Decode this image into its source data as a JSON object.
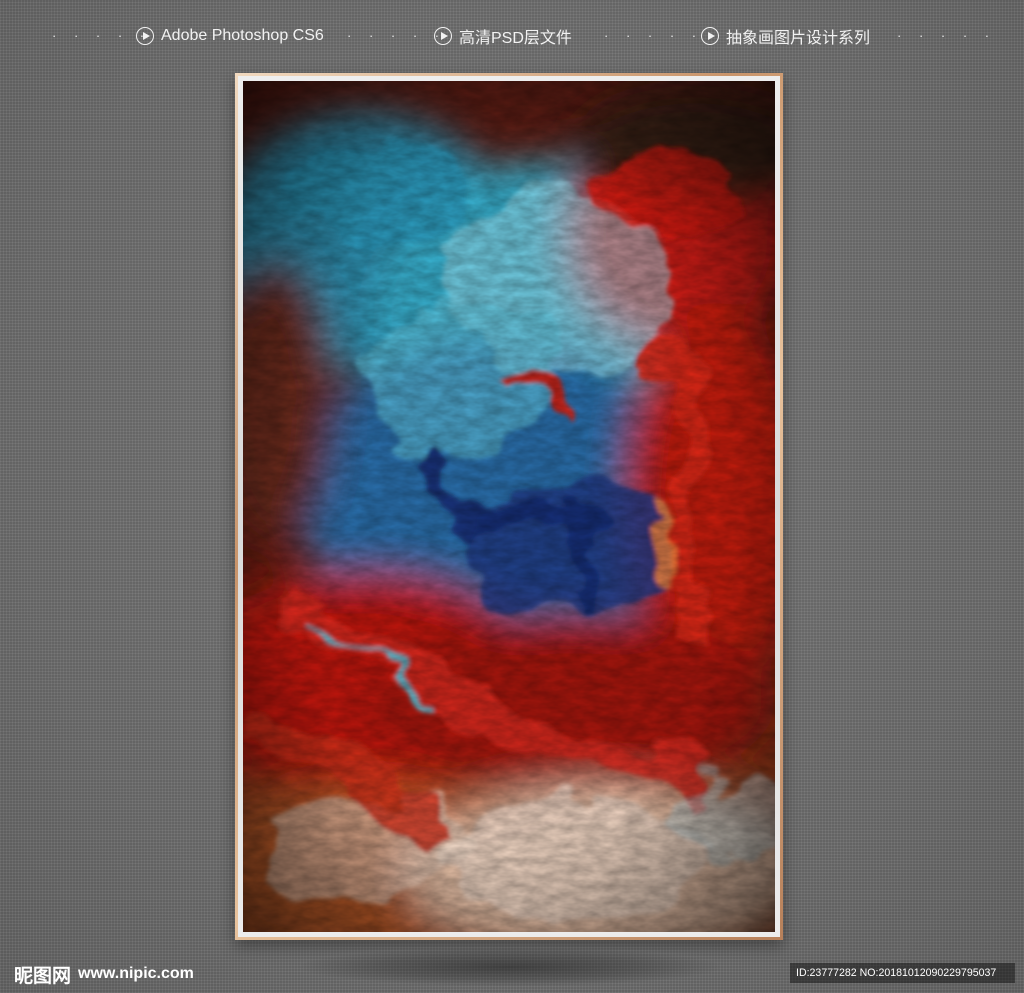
{
  "header": {
    "dots": "· · · · ·",
    "items": [
      {
        "label": "Adobe Photoshop CS6",
        "icon": "play-circle-icon"
      },
      {
        "label": "高清PSD层文件",
        "icon": "play-circle-icon"
      },
      {
        "label": "抽象画图片设计系列",
        "icon": "play-circle-icon"
      }
    ]
  },
  "artwork": {
    "palette": {
      "teal": "#2fa6c9",
      "deep_blue": "#24478f",
      "red": "#d41414",
      "burnt_orange": "#c4521c",
      "cream": "#ecc7ad",
      "frame_gold": "#c9946a"
    }
  },
  "watermark": {
    "site_name": "昵图网",
    "url": "www.nipic.com",
    "id_text": "ID:23777282 NO:20181012090229795037"
  }
}
